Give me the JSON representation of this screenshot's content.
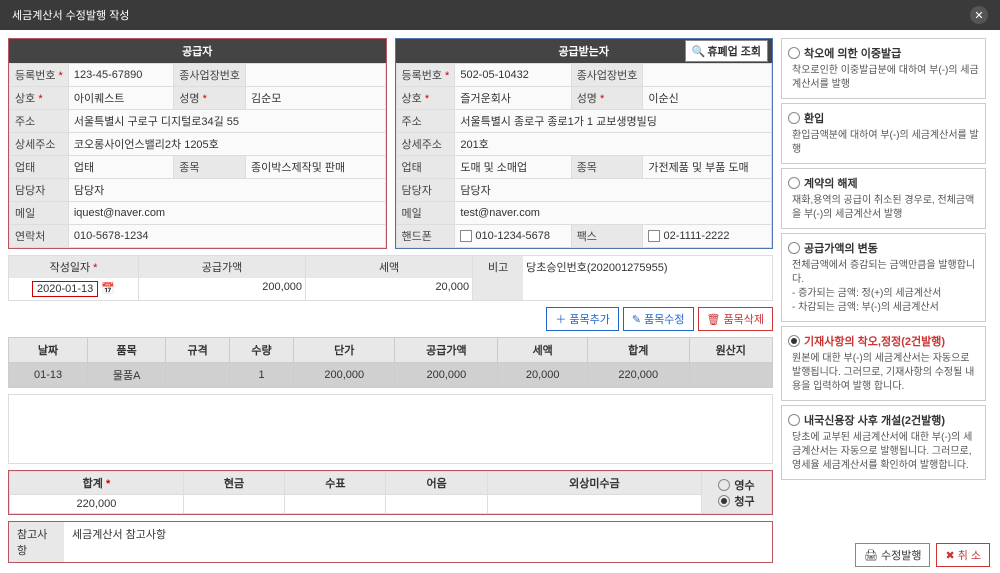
{
  "window": {
    "title": "세금계산서 수정발행 작성"
  },
  "supplier": {
    "header": "공급자",
    "labels": {
      "regNo": "등록번호",
      "subBizNo": "종사업장번호",
      "company": "상호",
      "repName": "성명",
      "address": "주소",
      "detailAddr": "상세주소",
      "bizType": "업태",
      "bizItem": "종목",
      "contact": "담당자",
      "email": "메일",
      "phone": "연락처"
    },
    "values": {
      "regNo": "123-45-67890",
      "subBizNo": "",
      "company": "아이퀘스트",
      "repName": "김순모",
      "address": "서울특별시 구로구 디지털로34길 55",
      "detailAddr": "코오롱사이언스밸리2차 1205호",
      "bizType": "업태",
      "bizItem": "종이박스제작및 판매",
      "contact": "담당자",
      "email": "iquest@naver.com",
      "phone": "010-5678-1234"
    }
  },
  "receiver": {
    "header": "공급받는자",
    "lookupBtn": "휴폐업 조회",
    "labels": {
      "regNo": "등록번호",
      "subBizNo": "종사업장번호",
      "company": "상호",
      "repName": "성명",
      "address": "주소",
      "detailAddr": "상세주소",
      "bizType": "업태",
      "bizItem": "종목",
      "contact": "담당자",
      "email": "메일",
      "mobile": "핸드폰",
      "fax": "팩스"
    },
    "values": {
      "regNo": "502-05-10432",
      "subBizNo": "",
      "company": "즐거운회사",
      "repName": "이순신",
      "address": "서울특별시 종로구 종로1가 1 교보생명빌딩",
      "detailAddr": "201호",
      "bizType": "도매 및 소매업",
      "bizItem": "가전제품 및 부품 도매",
      "contact": "담당자",
      "email": "test@naver.com",
      "mobile": "010-1234-5678",
      "fax": "02-1111-2222"
    }
  },
  "dateRow": {
    "labels": {
      "date": "작성일자",
      "supplyAmt": "공급가액",
      "tax": "세액",
      "remarks": "비고"
    },
    "values": {
      "date": "2020-01-13",
      "supplyAmt": "200,000",
      "tax": "20,000",
      "remarks": "당초승인번호(202001275955)"
    }
  },
  "itemBtns": {
    "add": "품목추가",
    "edit": "품목수정",
    "del": "품목삭제"
  },
  "items": {
    "headers": [
      "날짜",
      "품목",
      "규격",
      "수량",
      "단가",
      "공급가액",
      "세액",
      "합계",
      "원산지"
    ],
    "rows": [
      [
        "01-13",
        "물품A",
        "",
        "1",
        "200,000",
        "200,000",
        "20,000",
        "220,000",
        ""
      ]
    ]
  },
  "totals": {
    "headers": [
      "합계",
      "현금",
      "수표",
      "어음",
      "외상미수금"
    ],
    "receiptOptions": [
      "영수",
      "청구"
    ],
    "sum": "220,000"
  },
  "remarks": {
    "label": "참고사항",
    "value": "세금계산서 참고사항"
  },
  "options": [
    {
      "title": "착오에 의한 이중발급",
      "desc": "착오로인한 이중발급분에 대하여 부(-)의 세금계산서를 발행"
    },
    {
      "title": "환입",
      "desc": "환입금액분에 대하여 부(-)의 세금계산서를 발행"
    },
    {
      "title": "계약의 해제",
      "desc": "재화,용역의 공급이 취소된 경우로, 전체금액을 부(-)의 세금계산서 발행"
    },
    {
      "title": "공급가액의 변동",
      "desc": "전체금액에서 증감되는 금액만큼을 발행합니다.\n- 증가되는 금액: 정(+)의 세금계산서\n- 차감되는 금액: 부(-)의 세금계산서"
    },
    {
      "title": "기재사항의 착오,정정(2건발행)",
      "desc": "원본에 대한 부(-)의 세금계산서는 자동으로 발행됩니다. 그러므로, 기재사항의 수정될 내용을 입력하여 발행 합니다.",
      "selected": true
    },
    {
      "title": "내국신용장 사후 개설(2건발행)",
      "desc": "당초에 교부된 세금계산서에 대한 부(-)의 세금계산서는 자동으로 발행됩니다. 그러므로, 영세율 세금계산서를 확인하여 발행합니다."
    }
  ],
  "footer": {
    "submit": "수정발행",
    "cancel": "취 소"
  }
}
